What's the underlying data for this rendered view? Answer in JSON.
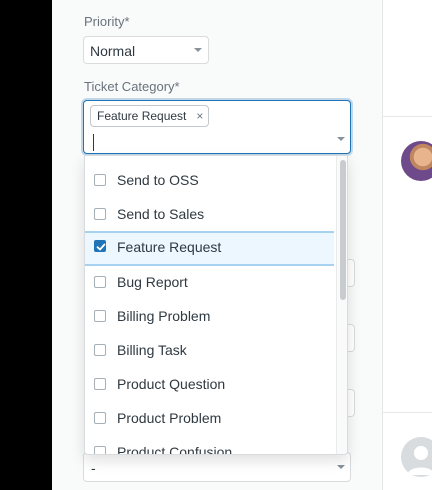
{
  "form": {
    "priority_label": "Priority*",
    "priority_value": "Normal",
    "category_label": "Ticket Category*",
    "category_tags": [
      {
        "label": "Feature Request"
      }
    ],
    "tag_remove_glyph": "×",
    "bottom_select_value": "-"
  },
  "dropdown": {
    "options": [
      {
        "label": "Send to OSS",
        "checked": false
      },
      {
        "label": "Send to Sales",
        "checked": false
      },
      {
        "label": "Feature Request",
        "checked": true
      },
      {
        "label": "Bug Report",
        "checked": false
      },
      {
        "label": "Billing Problem",
        "checked": false
      },
      {
        "label": "Billing Task",
        "checked": false
      },
      {
        "label": "Product Question",
        "checked": false
      },
      {
        "label": "Product Problem",
        "checked": false
      },
      {
        "label": "Product Confusion",
        "checked": false
      }
    ]
  },
  "colors": {
    "accent": "#1f73b7",
    "selected_bg": "#edf7ff",
    "panel_bg": "#f9fafa"
  },
  "icons": {
    "checkbox": "checkbox-icon",
    "checkmark": "checkmark-icon",
    "chevron": "chevron-down-icon",
    "tag_remove": "close-icon",
    "user_avatar": "user-avatar-photo",
    "default_avatar": "default-avatar-icon"
  }
}
